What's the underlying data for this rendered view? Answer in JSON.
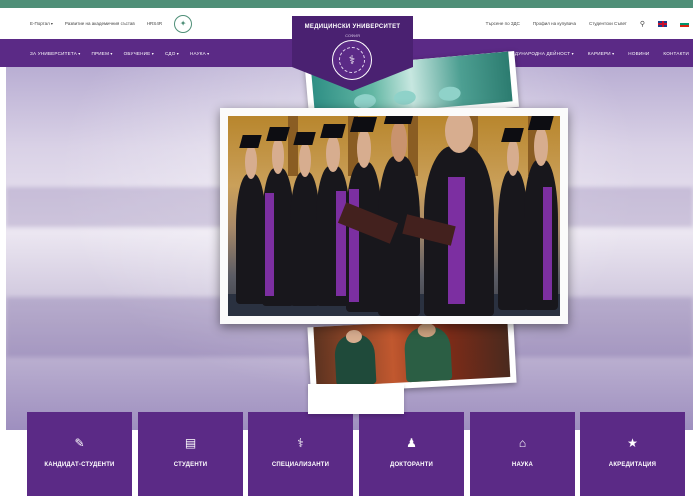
{
  "topbar": {
    "left_items": [
      {
        "label": "Е-Портал",
        "dropdown": true
      },
      {
        "label": "Развитие на академичния състав",
        "dropdown": false
      },
      {
        "label": "HRS4R",
        "dropdown": false
      }
    ],
    "right_items": [
      {
        "label": "Търсене по ЗДС"
      },
      {
        "label": "Профил на купувача"
      },
      {
        "label": "Студентски Съвет"
      }
    ]
  },
  "brand": {
    "title": "МЕДИЦИНСКИ УНИВЕРСИТЕТ",
    "subtitle": "СОФИЯ"
  },
  "nav": {
    "left": [
      {
        "label": "ЗА УНИВЕРСИТЕТА",
        "dropdown": true
      },
      {
        "label": "ПРИЕМ",
        "dropdown": true
      },
      {
        "label": "ОБУЧЕНИЕ",
        "dropdown": true
      },
      {
        "label": "СДО",
        "dropdown": true
      },
      {
        "label": "НАУКА",
        "dropdown": true
      }
    ],
    "right": [
      {
        "label": "МЕЖДУНАРОДНА ДЕЙНОСТ",
        "dropdown": true
      },
      {
        "label": "КАРИЕРИ",
        "dropdown": true
      },
      {
        "label": "НОВИНИ",
        "dropdown": false
      },
      {
        "label": "КОНТАКТИ",
        "dropdown": false
      }
    ]
  },
  "tiles": [
    {
      "label": "КАНДИДАТ-СТУДЕНТИ",
      "icon": "edit-icon"
    },
    {
      "label": "СТУДЕНТИ",
      "icon": "id-card-icon"
    },
    {
      "label": "СПЕЦИАЛИЗАНТИ",
      "icon": "stethoscope-icon"
    },
    {
      "label": "ДОКТОРАНТИ",
      "icon": "user-graduate-icon"
    },
    {
      "label": "НАУКА",
      "icon": "university-icon"
    },
    {
      "label": "АКРЕДИТАЦИЯ",
      "icon": "star-icon"
    }
  ],
  "colors": {
    "accent_green": "#4f8f78",
    "brand_purple": "#5b2a86",
    "brand_purple_dark": "#4a2171"
  }
}
